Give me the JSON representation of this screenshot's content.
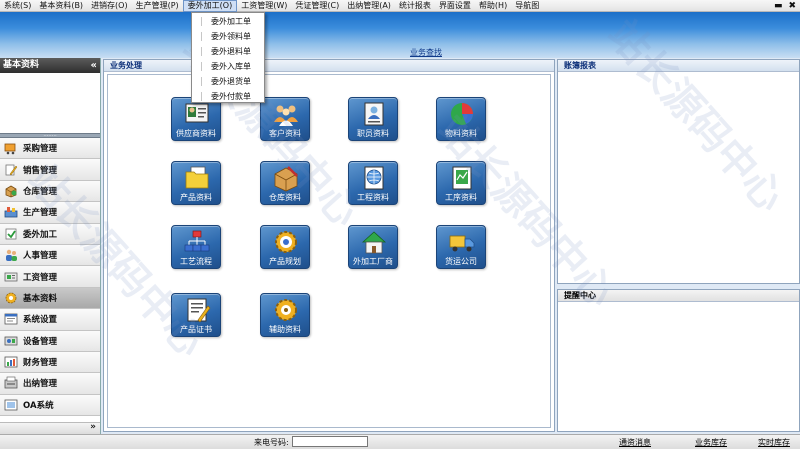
{
  "menubar": {
    "items": [
      "系统(S)",
      "基本资料(B)",
      "进销存(O)",
      "生产管理(P)",
      "委外加工(O)",
      "工资管理(W)",
      "凭证管理(C)",
      "出纳管理(A)",
      "统计报表",
      "界面设置",
      "帮助(H)",
      "导航图"
    ],
    "active_index": 4
  },
  "window_controls": {
    "minimize": "▬",
    "close": "✖"
  },
  "banner": {
    "link": "业务查找"
  },
  "dropdown": {
    "items": [
      "委外加工单",
      "委外领料单",
      "委外退料单",
      "委外入库单",
      "委外退货单",
      "委外付款单"
    ]
  },
  "sidebar": {
    "header": "基本资料",
    "collapse": "«",
    "items": [
      "采购管理",
      "销售管理",
      "仓库管理",
      "生产管理",
      "委外加工",
      "人事管理",
      "工资管理",
      "基本资料",
      "系统设置",
      "设备管理",
      "财务管理",
      "出纳管理",
      "OA系统"
    ],
    "active_index": 7,
    "scroll_arrow": "»"
  },
  "business": {
    "title": "业务处理",
    "tiles": [
      "供应商资料",
      "客户资料",
      "职员资料",
      "物料资料",
      "产品资料",
      "仓库资料",
      "工程资料",
      "工序资料",
      "工艺流程",
      "产品规划",
      "外加工厂商",
      "货运公司",
      "产品证书",
      "辅助资料"
    ]
  },
  "ledger": {
    "title": "账簿报表"
  },
  "reminder": {
    "title": "提醒中心"
  },
  "statusbar": {
    "phone_label": "来电号码:",
    "phone_value": "",
    "links": [
      "通资消息",
      "业务库存",
      "实时库存"
    ]
  },
  "watermark": "站长源码中心",
  "colors": {
    "tile": "#2c68ad",
    "banner": "#1c6fc8",
    "panel_title": "#0b2e78"
  }
}
